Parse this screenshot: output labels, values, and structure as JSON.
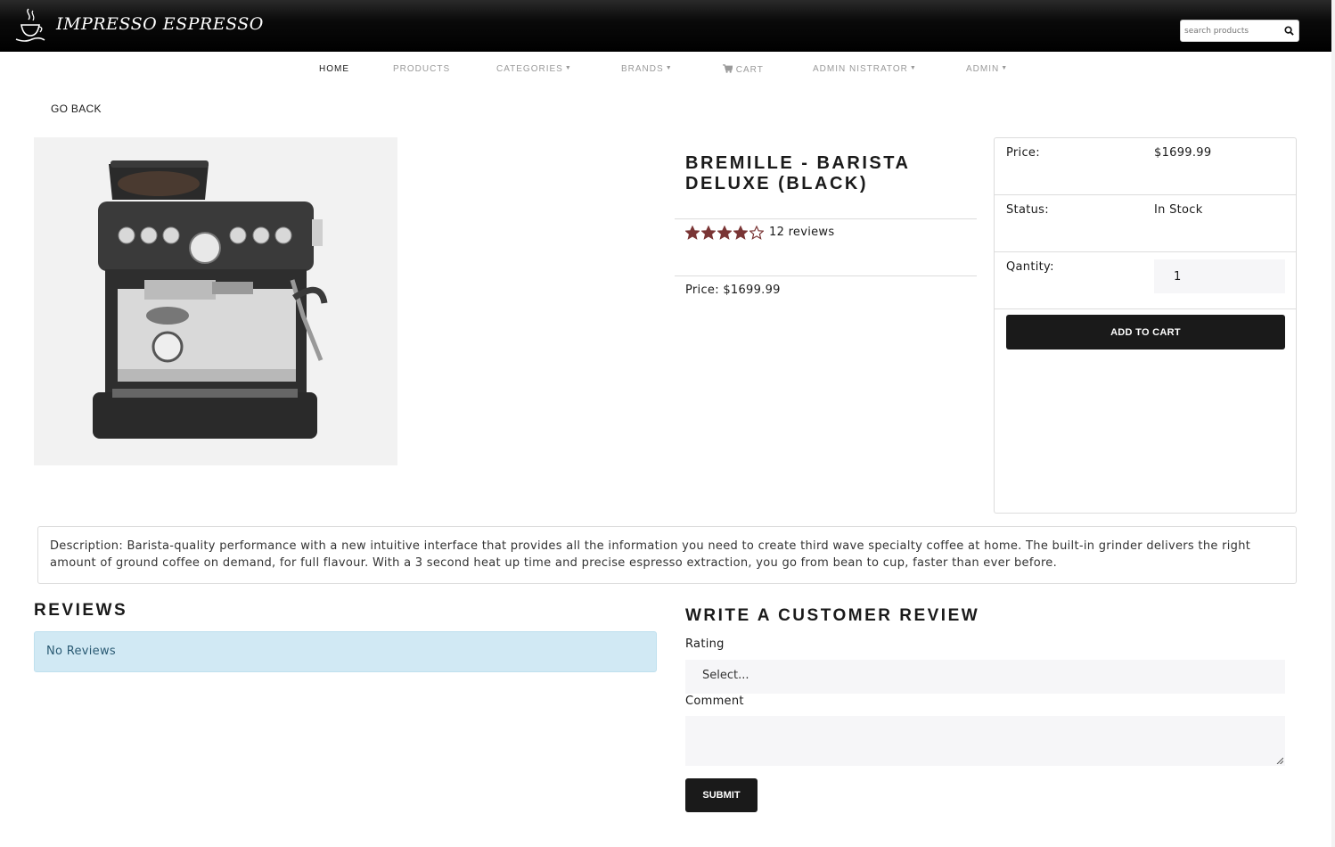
{
  "header": {
    "brand": "Impresso Espresso",
    "search_placeholder": "search products"
  },
  "nav": {
    "home": "HOME",
    "products": "PRODUCTS",
    "categories": "CATEGORIES",
    "brands": "BRANDS",
    "cart": "CART",
    "admin_user": "ADMIN NISTRATOR",
    "admin": "ADMIN"
  },
  "go_back": "GO BACK",
  "product": {
    "name": "BREMILLE - BARISTA DELUXE (BLACK)",
    "rating": 4,
    "rating_max": 5,
    "reviews_text": "12 reviews",
    "price_line": "Price: $1699.99",
    "description": "Description: Barista-quality performance with a new intuitive interface that provides all the information you need to create third wave specialty coffee at home. The built-in grinder delivers the right amount of ground coffee on demand, for full flavour. With a 3 second heat up time and precise espresso extraction, you go from bean to cup, faster than ever before."
  },
  "card": {
    "price_label": "Price:",
    "price_value": "$1699.99",
    "status_label": "Status:",
    "status_value": "In Stock",
    "qty_label": "Qantity:",
    "qty_value": "1",
    "add_to_cart": "ADD TO CART"
  },
  "reviews": {
    "heading": "REVIEWS",
    "empty_message": "No Reviews"
  },
  "review_form": {
    "heading": "WRITE A CUSTOMER REVIEW",
    "rating_label": "Rating",
    "rating_selected": "Select...",
    "comment_label": "Comment",
    "submit": "SUBMIT"
  },
  "colors": {
    "star": "#7a3535",
    "alert_bg": "#d1e9f4",
    "button_dark": "#1a1a1a"
  }
}
